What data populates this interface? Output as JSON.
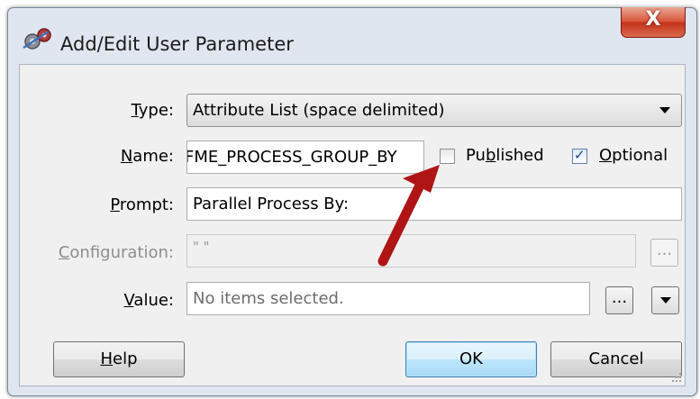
{
  "window": {
    "title": "Add/Edit User Parameter",
    "close_label": "X"
  },
  "form": {
    "type": {
      "label": "Type:",
      "label_underline": "T",
      "label_rest": "ype:",
      "value": "Attribute List (space delimited)"
    },
    "name": {
      "label_underline": "N",
      "label_rest": "ame:",
      "value": "FME_PROCESS_GROUP_BY"
    },
    "published": {
      "label_pre": "Pu",
      "label_underline": "b",
      "label_rest": "lished",
      "checked": false
    },
    "optional": {
      "label_underline": "O",
      "label_rest": "ptional",
      "checked": true
    },
    "prompt": {
      "label_underline": "P",
      "label_rest": "rompt:",
      "value": "Parallel Process By:"
    },
    "configuration": {
      "label_underline": "C",
      "label_rest": "onfiguration:",
      "value": "\" \"",
      "enabled": false,
      "browse_label": "..."
    },
    "value": {
      "label_underline": "V",
      "label_rest": "alue:",
      "placeholder": "No items selected.",
      "browse_label": "..."
    }
  },
  "buttons": {
    "help": {
      "label_underline": "H",
      "label_rest": "elp"
    },
    "ok": {
      "label": "OK"
    },
    "cancel": {
      "label": "Cancel"
    }
  },
  "annotation": {
    "arrow_color": "#b01515",
    "points_to": "published-checkbox"
  },
  "colors": {
    "close_button": "#c9412a",
    "default_button_border": "#3c7fb1",
    "disabled_text": "#8d8d8d"
  }
}
